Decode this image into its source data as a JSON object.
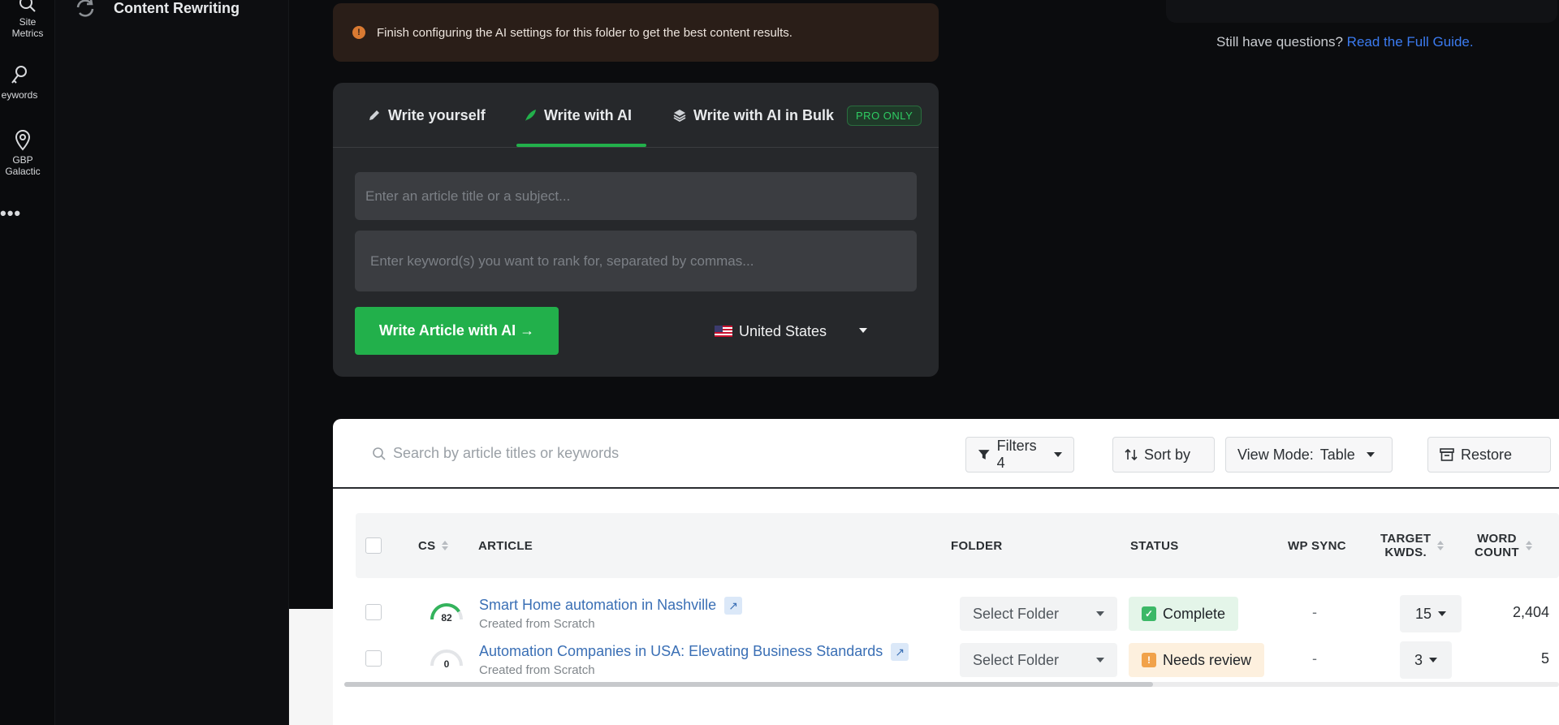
{
  "rail": {
    "items": [
      {
        "label": "Site\nMetrics",
        "line1": "Site",
        "line2": "Metrics",
        "icon": "search-icon"
      },
      {
        "label": "Keywords",
        "line1": "eywords",
        "icon": "key-icon"
      },
      {
        "label": "GBP Galactic",
        "line1": "GBP",
        "line2": "Galactic",
        "icon": "map-pin-icon"
      }
    ],
    "more": "•••"
  },
  "sidebar": {
    "content_rewriting": "Content Rewriting"
  },
  "banner": {
    "icon": "!",
    "text": "Finish configuring the AI settings for this folder to get the best content results."
  },
  "help": {
    "prefix": "Still have questions?",
    "link": "Read the Full Guide."
  },
  "editor": {
    "tabs": [
      {
        "label": "Write yourself",
        "icon": "pencil-icon"
      },
      {
        "label": "Write with AI",
        "icon": "feather-icon",
        "active": true
      },
      {
        "label": "Write with AI in Bulk",
        "icon": "layers-icon"
      }
    ],
    "pro_badge": "PRO ONLY",
    "title_placeholder": "Enter an article title or a subject...",
    "keywords_placeholder": "Enter keyword(s) you want to rank for, separated by commas...",
    "submit_label": "Write Article with AI →",
    "country": "United States",
    "accent": "#22b04b"
  },
  "toolbar": {
    "search_placeholder": "Search by article titles or keywords",
    "filters_label": "Filters 4",
    "sort_label": "Sort by",
    "view_mode_label": "View Mode:",
    "view_mode_value": "Table",
    "restore_label": "Restore"
  },
  "table": {
    "headers": {
      "cs": "CS",
      "article": "ARTICLE",
      "folder": "FOLDER",
      "status": "STATUS",
      "wp_sync": "WP SYNC",
      "target_kwds_1": "TARGET",
      "target_kwds_2": "KWDS.",
      "word_count_1": "WORD",
      "word_count_2": "COUNT"
    },
    "rows": [
      {
        "cs": "82",
        "cs_fraction": 0.82,
        "title": "Smart Home automation in Nashville",
        "subtitle": "Created from Scratch",
        "folder": "Select Folder",
        "status": "Complete",
        "status_icon": "✓",
        "wp_sync": "-",
        "target_kwds": "15",
        "word_count": "2,404"
      },
      {
        "cs": "0",
        "cs_fraction": 0.0,
        "title": "Automation Companies in USA: Elevating Business Standards",
        "subtitle": "Created from Scratch",
        "folder": "Select Folder",
        "status": "Needs review",
        "status_icon": "!",
        "wp_sync": "-",
        "target_kwds": "3",
        "word_count": "5"
      }
    ]
  }
}
